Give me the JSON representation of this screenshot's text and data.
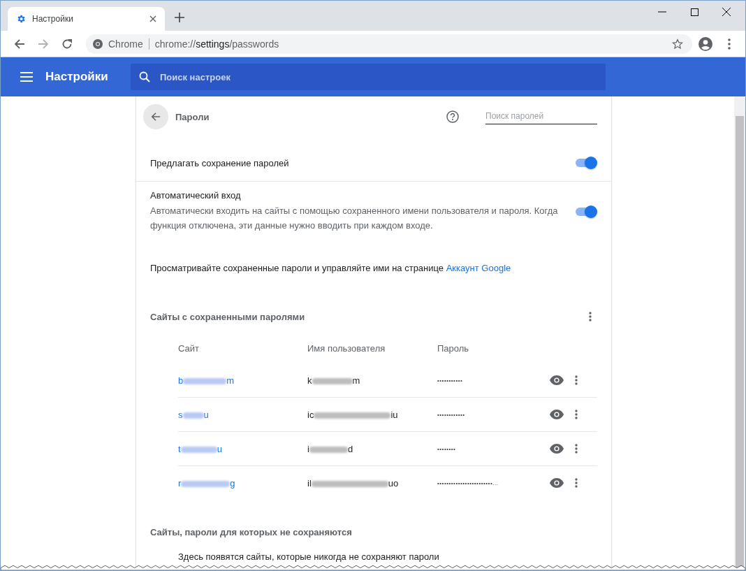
{
  "tab": {
    "title": "Настройки",
    "selected": true
  },
  "address_bar": {
    "origin": "Chrome",
    "url_scheme": "chrome://",
    "url_host": "settings",
    "url_path": "/passwords"
  },
  "header": {
    "title": "Настройки",
    "search": {
      "placeholder": "Поиск настроек"
    }
  },
  "page": {
    "title": "Пароли",
    "search": {
      "placeholder": "Поиск паролей"
    },
    "settings": [
      {
        "label": "Предлагать сохранение паролей",
        "on": true
      },
      {
        "label": "Автоматический вход",
        "description": "Автоматически входить на сайты с помощью сохраненного имени пользователя и пароля. Когда функция отключена, эти данные нужно вводить при каждом входе.",
        "on": true
      }
    ],
    "account_note": {
      "text": "Просматривайте сохраненные пароли и управляйте ими на странице",
      "link": "Аккаунт Google"
    },
    "saved": {
      "title": "Сайты с сохраненными паролями",
      "columns": [
        "Сайт",
        "Имя пользователя",
        "Пароль"
      ],
      "rows": [
        {
          "site_start": "b",
          "site_end": "m",
          "user_start": "k",
          "user_end": "m",
          "password": "•••••••••••"
        },
        {
          "site_start": "s",
          "site_end": "u",
          "user_start": "ic",
          "user_end": "iu",
          "password": "••••••••••••"
        },
        {
          "site_start": "t",
          "site_end": "u",
          "user_start": "i",
          "user_end": "d",
          "password": "••••••••"
        },
        {
          "site_start": "r",
          "site_end": "g",
          "user_start": "il",
          "user_end": "uo",
          "password": "••••••••••••••••••••••••…"
        }
      ]
    },
    "never_saved": {
      "title": "Сайты, пароли для которых не сохраняются",
      "note": "Здесь появятся сайты, которые никогда не сохраняют пароли"
    }
  }
}
